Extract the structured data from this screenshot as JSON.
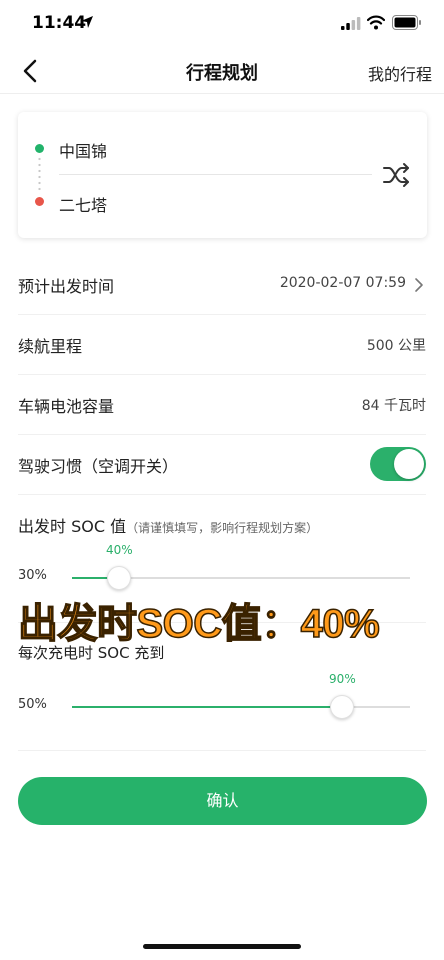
{
  "status_bar": {
    "time": "11:44"
  },
  "nav": {
    "title": "行程规划",
    "right_link": "我的行程"
  },
  "route": {
    "origin": "中国锦",
    "destination": "二七塔"
  },
  "settings": [
    {
      "label": "预计出发时间",
      "value": "2020-02-07 07:59"
    },
    {
      "label": "续航里程",
      "value": "500 公里"
    },
    {
      "label": "车辆电池容量",
      "value": "84 千瓦时"
    },
    {
      "label": "驾驶习惯（空调开关）",
      "toggle_on": true
    }
  ],
  "departure_soc": {
    "heading": "出发时 SOC 值",
    "note": "（请谨慎填写，影响行程规划方案）",
    "min_label": "30%",
    "value_label": "40%",
    "value_fraction": 0.14
  },
  "overlay_caption": "出发时SOC值：40%",
  "charge_soc": {
    "heading": "每次充电时 SOC 充到",
    "min_label": "50%",
    "value_label": "90%",
    "value_fraction": 0.8
  },
  "confirm_label": "确认",
  "colors": {
    "accent": "#2bb06b",
    "start_dot": "#22b36b",
    "end_dot": "#e8564a",
    "caption": "#ff9a1a"
  }
}
